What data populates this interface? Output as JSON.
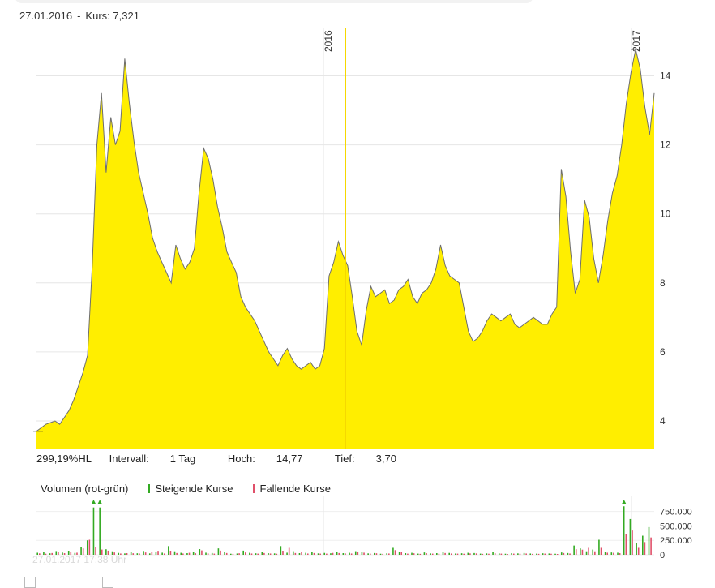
{
  "header": {
    "date": "27.01.2016",
    "separator": "-",
    "kurs_label": "Kurs:",
    "kurs_value": "7,321"
  },
  "stats": {
    "change": "299,19%HL",
    "interval_label": "Intervall:",
    "interval_value": "1 Tag",
    "high_label": "Hoch:",
    "high_value": "14,77",
    "low_label": "Tief:",
    "low_value": "3,70"
  },
  "volume_legend": {
    "title": "Volumen (rot-grün)",
    "rising": "Steigende Kurse",
    "falling": "Fallende Kurse"
  },
  "timestamp": "27.01.2017 17:38 Uhr",
  "colors": {
    "area_fill": "#ffee00",
    "line": "#6e6e6e",
    "cursor": "#f5d800",
    "rising": "#33aa22",
    "falling": "#e0506a",
    "grid": "#e6e6e6"
  },
  "chart_data": [
    {
      "type": "area",
      "x_labels": [
        "2016",
        "2017"
      ],
      "y_ticks": [
        4,
        6,
        8,
        10,
        12,
        14
      ],
      "ylim": [
        3.2,
        15.4
      ],
      "grid": true,
      "cursor": "27.01.2016",
      "series": [
        {
          "values": [
            3.7,
            3.8,
            3.9,
            3.95,
            4.0,
            3.9,
            4.1,
            4.3,
            4.6,
            5.0,
            5.4,
            5.9,
            8.5,
            12.0,
            13.5,
            11.2,
            12.8,
            12.0,
            12.4,
            14.5,
            13.2,
            12.1,
            11.2,
            10.6,
            10.0,
            9.3,
            8.9,
            8.6,
            8.3,
            8.0,
            9.1,
            8.7,
            8.4,
            8.6,
            9.0,
            10.6,
            11.9,
            11.6,
            11.0,
            10.2,
            9.6,
            8.9,
            8.6,
            8.3,
            7.6,
            7.3,
            7.1,
            6.9,
            6.6,
            6.3,
            6.0,
            5.8,
            5.6,
            5.9,
            6.1,
            5.8,
            5.6,
            5.5,
            5.6,
            5.7,
            5.5,
            5.6,
            6.1,
            8.2,
            8.6,
            9.2,
            8.8,
            8.5,
            7.6,
            6.6,
            6.2,
            7.2,
            7.9,
            7.6,
            7.7,
            7.8,
            7.4,
            7.5,
            7.8,
            7.9,
            8.1,
            7.6,
            7.4,
            7.7,
            7.8,
            8.0,
            8.4,
            9.1,
            8.5,
            8.2,
            8.1,
            8.0,
            7.3,
            6.6,
            6.3,
            6.4,
            6.6,
            6.9,
            7.1,
            7.0,
            6.9,
            7.0,
            7.1,
            6.8,
            6.7,
            6.8,
            6.9,
            7.0,
            6.9,
            6.8,
            6.8,
            7.1,
            7.3,
            11.3,
            10.5,
            8.9,
            7.7,
            8.1,
            10.4,
            9.9,
            8.7,
            8.0,
            8.8,
            9.8,
            10.6,
            11.1,
            12.0,
            13.2,
            14.1,
            14.77,
            14.2,
            13.1,
            12.3,
            13.5
          ]
        }
      ]
    },
    {
      "type": "bar",
      "y_ticks": [
        "750.000",
        "500.000",
        "250.000",
        "0"
      ],
      "ylim": [
        0,
        900000
      ],
      "series": [
        {
          "name": "Steigende Kurse",
          "values": [
            35000,
            42000,
            26000,
            64000,
            38000,
            70000,
            32000,
            140000,
            250000,
            820000,
            820000,
            95000,
            60000,
            32000,
            24000,
            54000,
            26000,
            66000,
            24000,
            42000,
            36000,
            150000,
            60000,
            34000,
            28000,
            45000,
            98000,
            36000,
            30000,
            110000,
            48000,
            18000,
            22000,
            72000,
            34000,
            26000,
            42000,
            28000,
            24000,
            150000,
            36000,
            62000,
            28000,
            34000,
            42000,
            24000,
            32000,
            26000,
            44000,
            28000,
            34000,
            62000,
            48000,
            24000,
            30000,
            18000,
            26000,
            120000,
            54000,
            28000,
            34000,
            20000,
            40000,
            24000,
            28000,
            46000,
            32000,
            22000,
            26000,
            34000,
            30000,
            20000,
            24000,
            44000,
            24000,
            18000,
            28000,
            24000,
            30000,
            22000,
            20000,
            26000,
            22000,
            18000,
            40000,
            30000,
            160000,
            110000,
            60000,
            90000,
            260000,
            46000,
            40000,
            36000,
            840000,
            620000,
            210000,
            330000,
            480000
          ]
        },
        {
          "name": "Fallende Kurse",
          "values": [
            24000,
            18000,
            30000,
            52000,
            28000,
            48000,
            36000,
            110000,
            260000,
            140000,
            90000,
            72000,
            40000,
            22000,
            28000,
            26000,
            22000,
            40000,
            52000,
            68000,
            22000,
            70000,
            30000,
            22000,
            34000,
            26000,
            76000,
            24000,
            20000,
            72000,
            30000,
            16000,
            26000,
            40000,
            22000,
            20000,
            30000,
            22000,
            18000,
            70000,
            120000,
            30000,
            50000,
            22000,
            30000,
            20000,
            20000,
            32000,
            30000,
            24000,
            22000,
            42000,
            36000,
            20000,
            26000,
            16000,
            22000,
            80000,
            44000,
            20000,
            26000,
            16000,
            28000,
            20000,
            18000,
            30000,
            22000,
            20000,
            18000,
            24000,
            24000,
            16000,
            18000,
            26000,
            20000,
            14000,
            20000,
            18000,
            22000,
            16000,
            16000,
            20000,
            18000,
            14000,
            30000,
            22000,
            96000,
            88000,
            120000,
            60000,
            120000,
            36000,
            34000,
            28000,
            360000,
            420000,
            120000,
            220000,
            300000
          ]
        }
      ]
    }
  ]
}
